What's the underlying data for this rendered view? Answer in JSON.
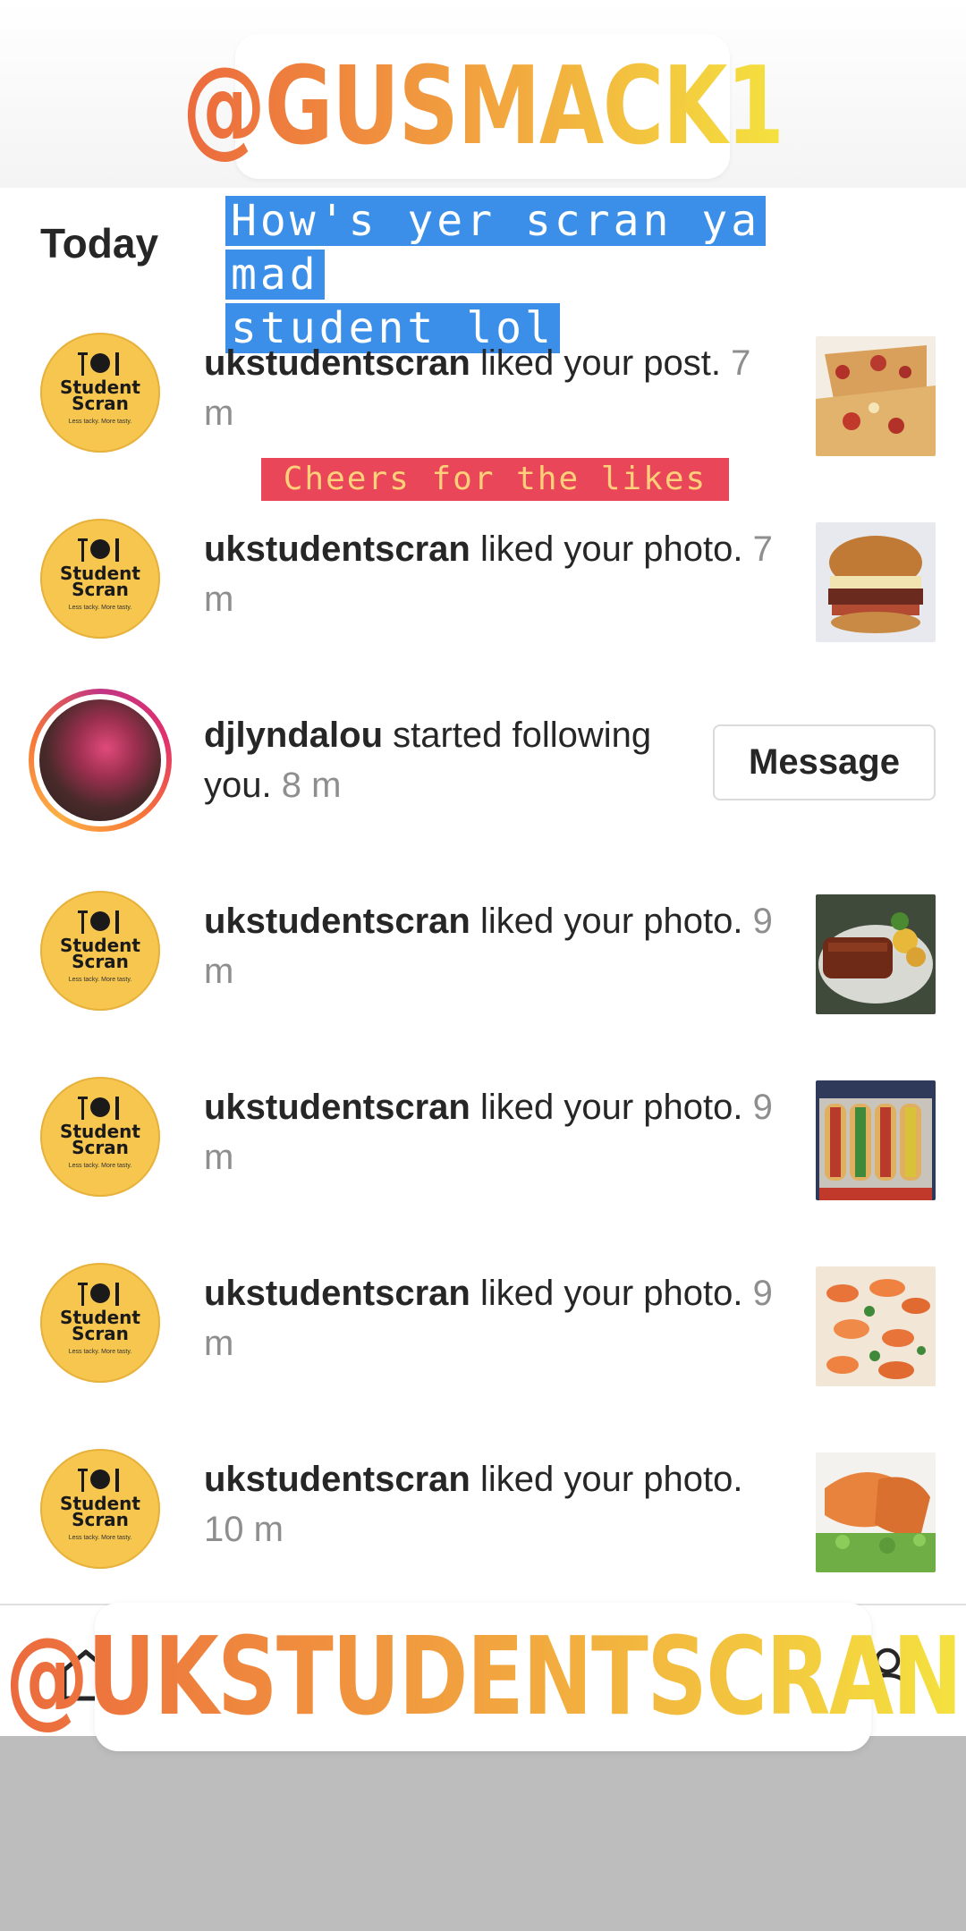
{
  "overlays": {
    "top_mention": "@GUSMACK1",
    "bottom_mention": "@UKSTUDENTSCRAN",
    "caption_blue_line1": "How's yer scran ya mad",
    "caption_blue_line2": "student lol",
    "caption_red": "Cheers for the likes"
  },
  "section": {
    "title": "Today"
  },
  "avatar_logo": {
    "line1": "Student",
    "line2": "Scran",
    "tagline": "Less tacky. More tasty."
  },
  "notifications": [
    {
      "user": "ukstudentscran",
      "action": " liked your post. ",
      "time": "7 m",
      "thumbnail": "pizza"
    },
    {
      "user": "ukstudentscran",
      "action": " liked your photo. ",
      "time": "7 m",
      "thumbnail": "burger"
    },
    {
      "user": "djlyndalou",
      "action": " started following you. ",
      "time": "8 m",
      "button": "Message"
    },
    {
      "user": "ukstudentscran",
      "action": " liked your photo. ",
      "time": "9 m",
      "thumbnail": "ribs"
    },
    {
      "user": "ukstudentscran",
      "action": " liked your photo. ",
      "time": "9 m",
      "thumbnail": "hot-dogs"
    },
    {
      "user": "ukstudentscran",
      "action": " liked your photo. ",
      "time": "9 m",
      "thumbnail": "prawns"
    },
    {
      "user": "ukstudentscran",
      "action": " liked your photo. ",
      "time": "10 m",
      "thumbnail": "salmon"
    }
  ],
  "nav": {
    "icons": [
      "home-icon",
      "profile-icon"
    ]
  },
  "colors": {
    "mention_gradient": [
      "#ec6a3e",
      "#f2a93f",
      "#f4e23f"
    ],
    "caption_blue_bg": "#3b8fe8",
    "caption_red_bg": "#e9465a",
    "avatar_yellow": "#f6c64f",
    "time_gray": "#8e8e8e"
  }
}
